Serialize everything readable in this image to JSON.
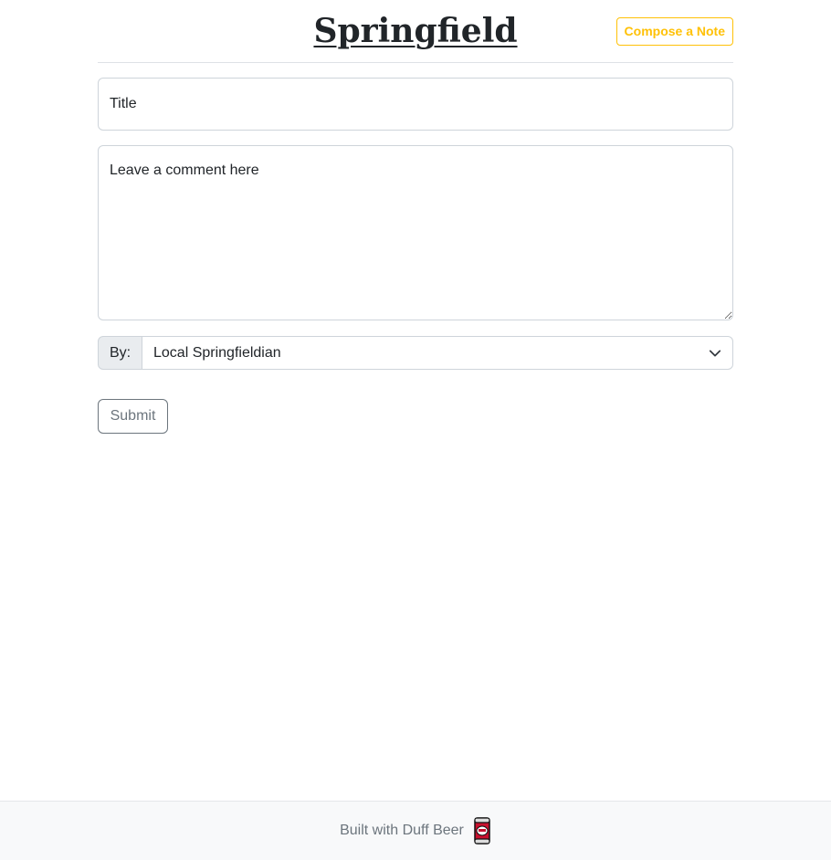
{
  "header": {
    "title": "Springfield",
    "compose_label": "Compose a Note"
  },
  "form": {
    "title_placeholder": "Title",
    "comment_placeholder": "Leave a comment here",
    "by_label": "By:",
    "by_selected": "Local Springfieldian",
    "submit_label": "Submit"
  },
  "footer": {
    "text": "Built with Duff Beer",
    "icon": "duff-beer-can-icon"
  },
  "colors": {
    "accent": "#ffc107",
    "secondary": "#6c757d",
    "border": "#ced4da",
    "footer_bg": "#f8f9fa"
  }
}
